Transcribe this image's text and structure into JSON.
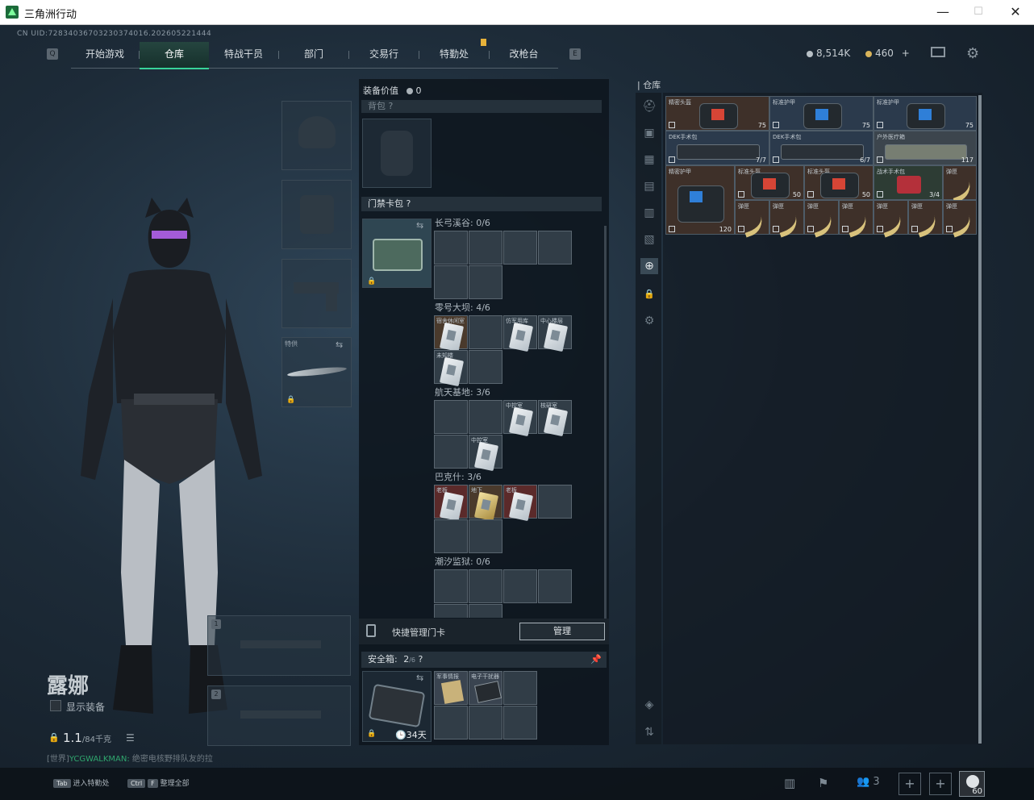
{
  "window": {
    "title": "三角洲行动",
    "min": "—",
    "max": "☐",
    "close": "✕"
  },
  "uid": "CN UID:72834036703230374016.202605221444",
  "nav": {
    "tabs": [
      "开始游戏",
      "仓库",
      "特战干员",
      "部门",
      "交易行",
      "特勤处",
      "改枪台"
    ],
    "active": 1,
    "left_key": "Q",
    "right_key": "E"
  },
  "currency": {
    "silver": "8,514K",
    "gold": "460",
    "plus": "+"
  },
  "equip": {
    "melee_label": "特供",
    "slot1_num": "1",
    "slot2_num": "2"
  },
  "character": {
    "name": "露娜",
    "show_gear": "显示装备",
    "weight": "1.1",
    "weight_max": "/84千克",
    "chat_prefix": "[世界]",
    "chat_user": "YCGWALKMAN:",
    "chat_msg": " 绝密电核野排队友的拉"
  },
  "mid": {
    "value_label": "装备价值",
    "value": "0",
    "backpack_label": "背包",
    "keycard_label": "门禁卡包",
    "maps": [
      {
        "name": "长弓溪谷: 0/6"
      },
      {
        "name": "零号大坝: 4/6"
      },
      {
        "name": "航天基地: 3/6"
      },
      {
        "name": "巴克什: 3/6"
      },
      {
        "name": "潮汐监狱: 0/6"
      }
    ],
    "zero_cards": [
      "宿舍休闲室",
      "仿军用库",
      "中心楼层",
      "未知楼"
    ],
    "space_cards": [
      "中控室",
      "核研室",
      "中控室"
    ],
    "bakesh_cards": [
      "老板",
      "地下",
      "老板"
    ],
    "quick_manage": "快捷管理门卡",
    "manage_btn": "管理",
    "safe_label": "安全箱:",
    "safe_count": "2",
    "safe_max": "/6",
    "safe_items": [
      "军事情报",
      "电子干扰器"
    ],
    "safe_days": "34天"
  },
  "stash": {
    "label": "仓库",
    "items": [
      {
        "name": "精密头盔",
        "count": "75"
      },
      {
        "name": "标准护甲",
        "count": "75"
      },
      {
        "name": "标准护甲",
        "count": "75"
      },
      {
        "name": "DEK手术包",
        "count": "7/7"
      },
      {
        "name": "DEK手术包",
        "count": "6/7"
      },
      {
        "name": "户外医疗箱",
        "count": "117"
      },
      {
        "name": "精密护甲",
        "count": "120"
      },
      {
        "name": "标准头盔",
        "count": "50"
      },
      {
        "name": "标准头盔",
        "count": "50"
      },
      {
        "name": "战术手术包",
        "count": "3/4"
      },
      {
        "name": "弹匣"
      }
    ],
    "ammo_label": "弹匣"
  },
  "bottom": {
    "tab_key": "Tab",
    "tab_label": "进入特勤处",
    "ctrl_key": "Ctrl",
    "f_key": "F",
    "ctrl_label": "整理全部",
    "friends": "3",
    "level": "60"
  }
}
